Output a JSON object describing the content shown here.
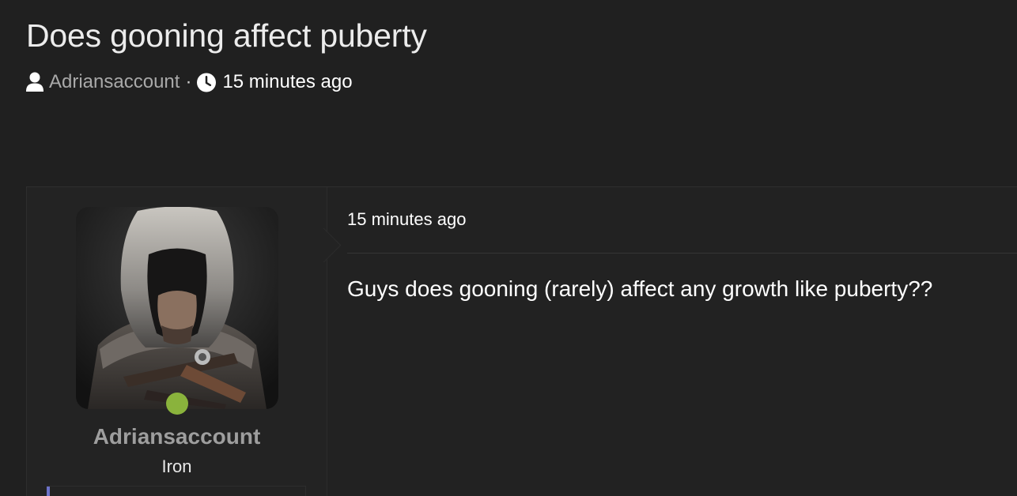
{
  "topic": {
    "title": "Does gooning affect puberty",
    "author": "Adriansaccount",
    "separator": "·",
    "time": "15 minutes ago"
  },
  "post": {
    "author": {
      "username": "Adriansaccount",
      "rank": "Iron",
      "online": true
    },
    "time": "15 minutes ago",
    "content": "Guys does gooning (rarely) affect any growth like puberty??"
  },
  "icons": {
    "author": "user-icon",
    "time": "clock-icon"
  },
  "colors": {
    "background": "#202020",
    "online_indicator": "#8ab33c",
    "stats_accent": "#6c72c9",
    "author_link": "#a9a9a9",
    "username": "#9e9e9e"
  }
}
